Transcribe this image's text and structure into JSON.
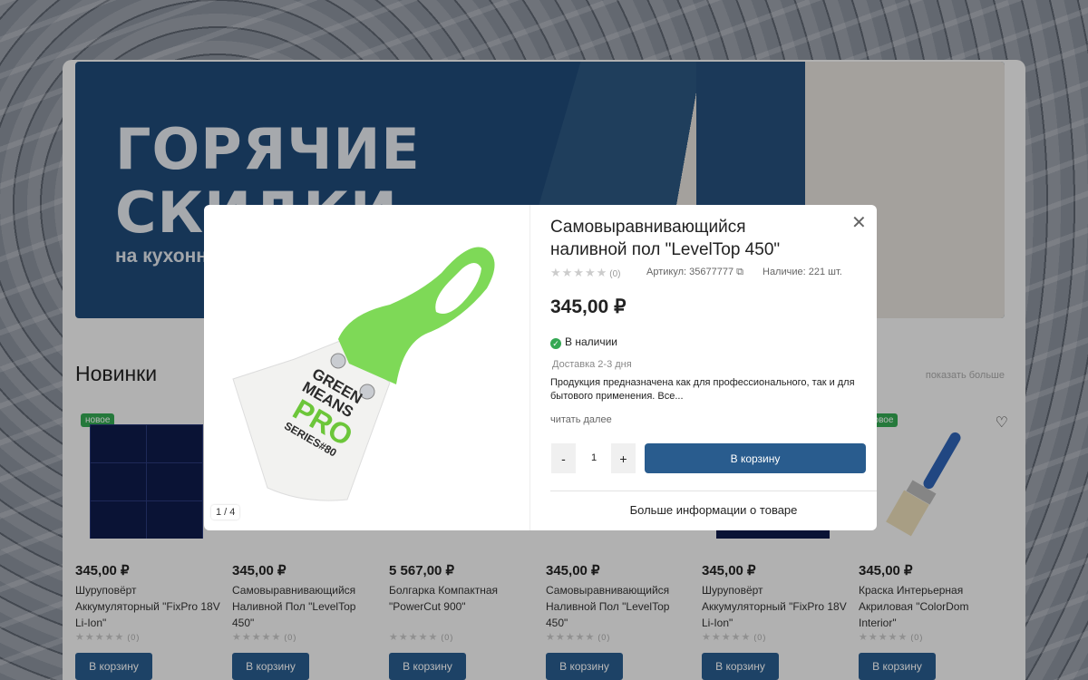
{
  "banner": {
    "headline_line1": "ГОРЯЧИЕ",
    "headline_line2": "СКИДКИ",
    "subtitle": "на кухонн"
  },
  "new_section": {
    "title": "Новинки",
    "show_more": "показать больше"
  },
  "products": [
    {
      "badge": "новое",
      "price": "345,00 ₽",
      "name": "Шуруповёрт Аккумуляторный \"FixPro 18V Li-Ion\"",
      "reviews": "(0)",
      "button": "В корзину"
    },
    {
      "badge": "",
      "price": "345,00 ₽",
      "name": "Самовыравнивающийся Наливной Пол \"LevelTop 450\"",
      "reviews": "(0)",
      "button": "В корзину"
    },
    {
      "badge": "",
      "price": "5 567,00 ₽",
      "name": "Болгарка Компактная \"PowerCut 900\"",
      "reviews": "(0)",
      "button": "В корзину"
    },
    {
      "badge": "",
      "price": "345,00 ₽",
      "name": "Самовыравнивающийся Наливной Пол \"LevelTop 450\"",
      "reviews": "(0)",
      "button": "В корзину"
    },
    {
      "badge": "",
      "price": "345,00 ₽",
      "name": "Шуруповёрт Аккумуляторный \"FixPro 18V Li-Ion\"",
      "reviews": "(0)",
      "button": "В корзину"
    },
    {
      "badge": "новое",
      "price": "345,00 ₽",
      "name": "Краска Интерьерная Акриловая \"ColorDom Interior\"",
      "reviews": "(0)",
      "button": "В корзину"
    }
  ],
  "modal": {
    "title": "Самовыравнивающийся наливной пол \"LevelTop 450\"",
    "rating_count": "(0)",
    "sku_label": "Артикул: 35677777",
    "stock_label": "Наличие: 221 шт.",
    "price": "345,00 ₽",
    "availability": "В наличии",
    "delivery": "Доставка 2-3 дня",
    "description": "Продукция предназначена как для профессионального, так и для бытового применения. Все...",
    "read_more": "читать далее",
    "quantity": "1",
    "minus": "-",
    "plus": "+",
    "add_to_cart": "В корзину",
    "more_info": "Больше информации о товаре",
    "gallery_counter": "1 / 4",
    "product_image_text": [
      "GREEN",
      "MEANS",
      "PRO",
      "SERIES#80"
    ]
  },
  "colors": {
    "accent": "#295c8e",
    "in_stock": "#34a853",
    "spatula_handle": "#7ed957"
  }
}
